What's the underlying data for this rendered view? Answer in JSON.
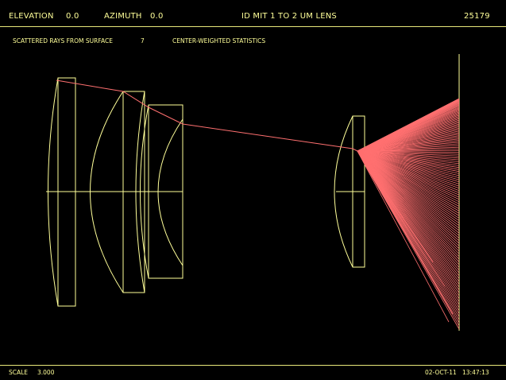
{
  "header": {
    "elevation_label": "ELEVATION",
    "elevation_value": "0.0",
    "azimuth_label": "AZIMUTH",
    "azimuth_value": "0.0",
    "title": "ID MIT 1 TO 2 UM LENS",
    "number": "25179"
  },
  "subheader": {
    "scattered_label": "SCATTERED RAYS FROM SURFACE",
    "surface_number": "7",
    "stats_label": "CENTER-WEIGHTED STATISTICS"
  },
  "footer": {
    "scale_label": "SCALE",
    "scale_value": "3.000",
    "date": "02-OCT-11",
    "time": "13:47:13"
  },
  "colors": {
    "lens_outline": "#ffff99",
    "ray": "#ff7070",
    "rule": "#e8e87a",
    "background": "#000000"
  }
}
